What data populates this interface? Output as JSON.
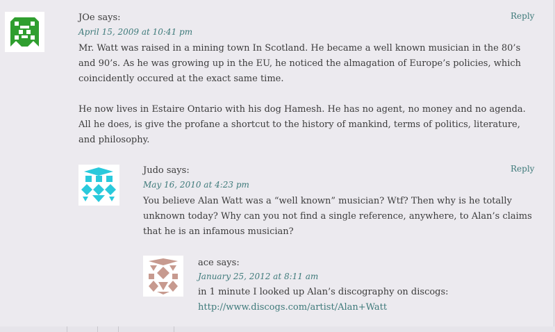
{
  "comments": [
    {
      "author": "JOe",
      "says": "says:",
      "date": "April 15, 2009 at 10:41 pm",
      "reply": "Reply",
      "avatar_color": "#2f9e2f",
      "paragraphs": [
        "Mr. Watt was raised in a mining town In Scotland. He became a well known musician in the 80’s and 90’s. As he was growing up in the EU, he noticed the almagation of Europe’s policies, which coincidently occured at the exact same time.",
        "He now lives in Estaire Ontario with his dog Hamesh. He has no agent, no money and no agenda. All he does, is give the profane a shortcut to the history of mankind, terms of politics, literature, and philosophy."
      ]
    },
    {
      "author": "Judo",
      "says": "says:",
      "date": "May 16, 2010 at 4:23 pm",
      "reply": "Reply",
      "avatar_color": "#29c9dc",
      "paragraphs": [
        "You believe Alan Watt was a “well known” musician? Wtf? Then why is he totally unknown today? Why can you not find a single reference, anywhere, to Alan’s claims that he is an infamous musician?"
      ]
    },
    {
      "author": "ace",
      "says": "says:",
      "date": "January 25, 2012 at 8:11 am",
      "avatar_color": "#c79a8f",
      "paragraphs": [
        "in 1 minute I looked up Alan’s discography on discogs:"
      ],
      "link": "http://www.discogs.com/artist/Alan+Watt"
    }
  ]
}
